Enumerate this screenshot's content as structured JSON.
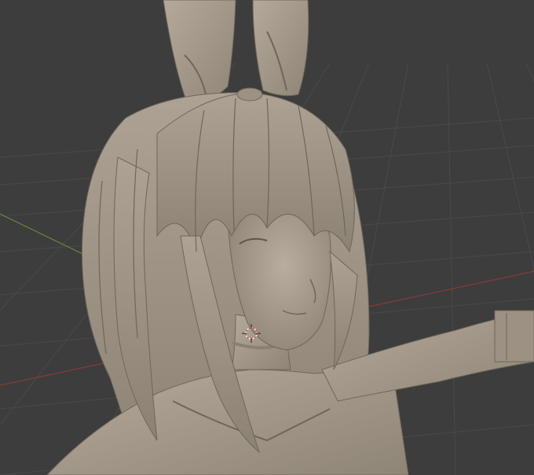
{
  "viewport": {
    "mode": "3d-viewport",
    "shading": "solid",
    "colors": {
      "background": "#3d3d3d",
      "grid_line": "#4a4a4a",
      "x_axis": "#8a3a3a",
      "y_axis": "#6a8a3a",
      "model": "#a59a8d",
      "model_shadow": "#6f6659",
      "model_highlight": "#c2b8aa",
      "cursor": "#e05050"
    }
  },
  "scene": {
    "object": "character-sculpt",
    "features": [
      "bunny-ears",
      "long-hair",
      "choker",
      "bodysuit",
      "arm-cuff"
    ]
  },
  "cursor": {
    "icon": "3d-cursor-icon"
  }
}
